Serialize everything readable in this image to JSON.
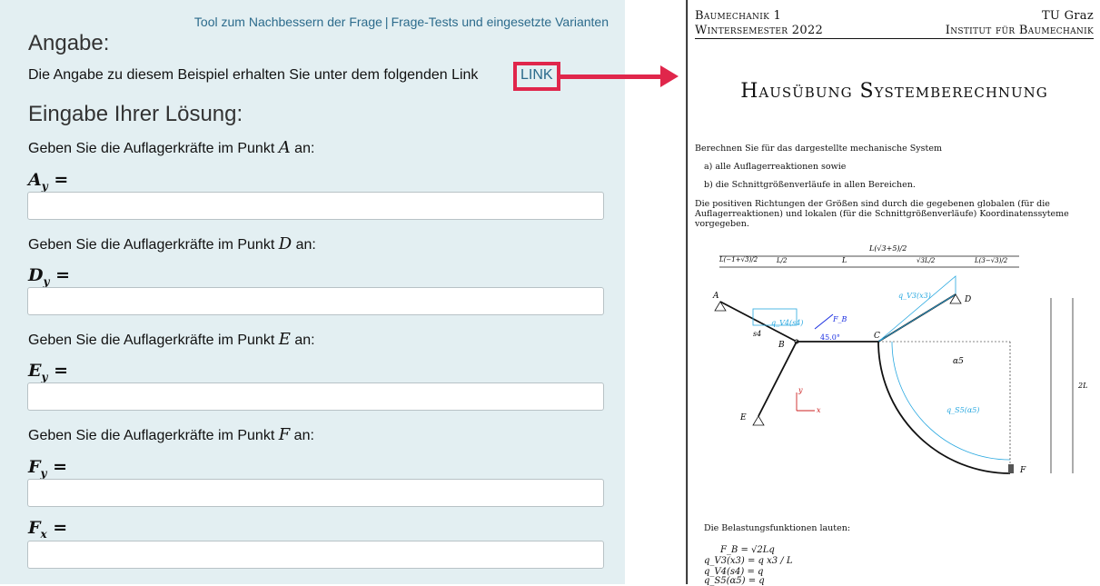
{
  "toolbar": {
    "improve_link": "Tool zum Nachbessern der Frage",
    "separator": "|",
    "tests_link": "Frage-Tests und eingesetzte Varianten"
  },
  "angabe": {
    "heading": "Angabe:",
    "text": "Die Angabe zu diesem Beispiel erhalten Sie unter dem folgenden Link",
    "link": "LINK"
  },
  "eingabe": {
    "heading": "Eingabe Ihrer Lösung:"
  },
  "questions": [
    {
      "prefix": "Geben Sie die Auflagerkräfte im Punkt",
      "point": "A",
      "suffix": "an:"
    },
    {
      "prefix": "Geben Sie die Auflagerkräfte im Punkt",
      "point": "D",
      "suffix": "an:"
    },
    {
      "prefix": "Geben Sie die Auflagerkräfte im Punkt",
      "point": "E",
      "suffix": "an:"
    },
    {
      "prefix": "Geben Sie die Auflagerkräfte im Punkt",
      "point": "F",
      "suffix": "an:"
    }
  ],
  "fields": [
    {
      "var": "A",
      "sub": "y",
      "value": ""
    },
    {
      "var": "D",
      "sub": "y",
      "value": ""
    },
    {
      "var": "E",
      "sub": "y",
      "value": ""
    },
    {
      "var": "F",
      "sub": "y",
      "value": ""
    },
    {
      "var": "F",
      "sub": "x",
      "value": ""
    }
  ],
  "doc": {
    "header_left_1": "Baumechanik 1",
    "header_right_1": "TU Graz",
    "header_left_2": "Wintersemester 2022",
    "header_right_2": "Institut für Baumechanik",
    "title": "Hausübung Systemberechnung",
    "intro": "Berechnen Sie für das dargestellte mechanische System",
    "item_a": "a)  alle Auflagerreaktionen sowie",
    "item_b": "b)  die Schnittgrößenverläufe in allen Bereichen.",
    "para": "Die positiven Richtungen der Größen sind durch die gegebenen globalen (für die Auflagerreaktionen) und lokalen (für die Schnittgrößenverläufe) Koordinatenssyteme vorgegeben.",
    "loads_intro": "Die Belastungsfunktionen lauten:",
    "eq1": "F_B = √2Lq",
    "eq2": "q_V3(x3) = q x3 / L",
    "eq3": "q_V4(s4) = q",
    "eq4": "q_S5(α5) = q",
    "fig_labels": {
      "A": "A",
      "B": "B",
      "C": "C",
      "D": "D",
      "E": "E",
      "F": "F",
      "angle": "45.0°",
      "fb": "F_B",
      "dimL": "L",
      "dim2L": "2L",
      "qv3": "q_V3(x3)",
      "qv4": "q_V4(s4)",
      "qs5": "q_S5(α5)",
      "alpha5": "α5",
      "s4": "s4",
      "x": "x",
      "y": "y"
    }
  },
  "colors": {
    "accent_red": "#e0264b",
    "panel_bg": "#e3eff2",
    "link_blue": "#2c6b8c",
    "load_blue": "#29a8e0"
  }
}
